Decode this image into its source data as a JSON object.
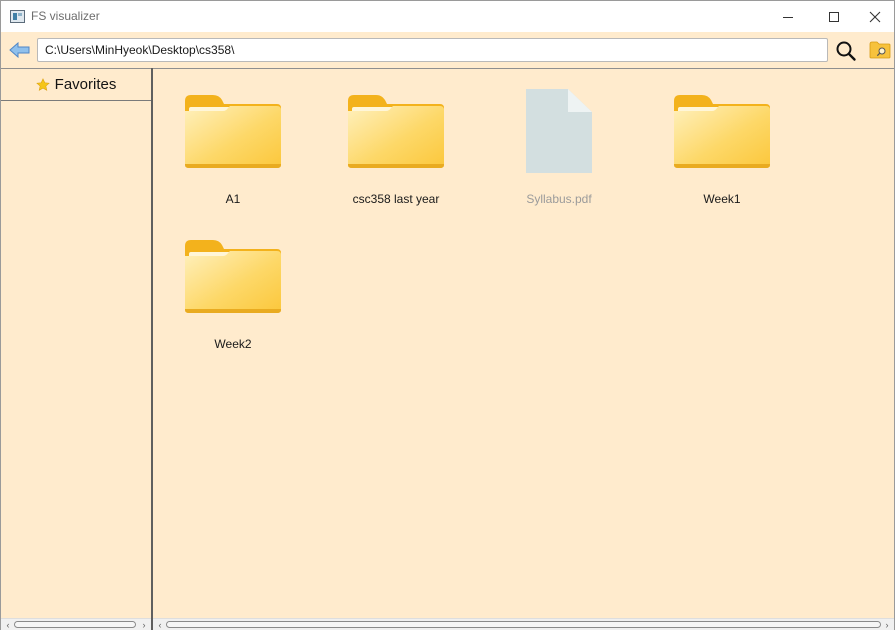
{
  "window": {
    "title": "FS visualizer",
    "controls": [
      "minimize-icon",
      "maximize-icon",
      "close-icon"
    ]
  },
  "toolbar": {
    "path": "C:\\Users\\MinHyeok\\Desktop\\cs358\\",
    "back_icon": "back-arrow-icon",
    "search_icon": "search-icon",
    "browse_icon": "folder-search-icon"
  },
  "sidebar": {
    "favorites_label": "Favorites",
    "favorites_icon": "star-icon"
  },
  "files": [
    {
      "name": "A1",
      "type": "folder"
    },
    {
      "name": "csc358 last year",
      "type": "folder"
    },
    {
      "name": "Syllabus.pdf",
      "type": "file"
    },
    {
      "name": "Week1",
      "type": "folder"
    },
    {
      "name": "Week2",
      "type": "folder"
    }
  ],
  "colors": {
    "background": "#ffebcd",
    "folder": "#fcca4a",
    "file": "#d3dfe0",
    "accent_arrow": "#6ba4dc"
  }
}
